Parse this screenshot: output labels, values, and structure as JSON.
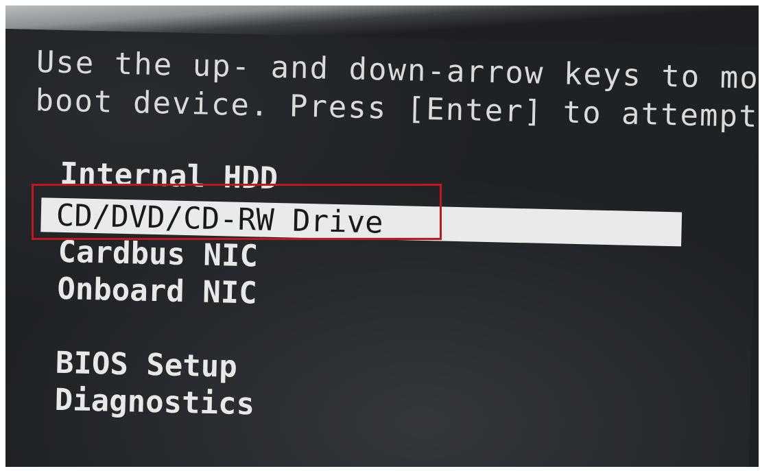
{
  "instruction": {
    "line1": "Use the up- and down-arrow keys to mov",
    "line2": "boot device. Press [Enter] to attempt"
  },
  "boot_menu": {
    "items": [
      {
        "label": "Internal HDD"
      },
      {
        "label": "CD/DVD/CD-RW Drive"
      },
      {
        "label": "Cardbus NIC"
      },
      {
        "label": "Onboard NIC"
      }
    ],
    "selected_index": 1
  },
  "other_options": {
    "items": [
      {
        "label": "BIOS Setup"
      },
      {
        "label": "Diagnostics"
      }
    ]
  },
  "colors": {
    "highlight_box": "#c3181b",
    "selection_bar": "#e9eaea",
    "screen_background": "#1f2225",
    "text": "#e4e4e4"
  }
}
